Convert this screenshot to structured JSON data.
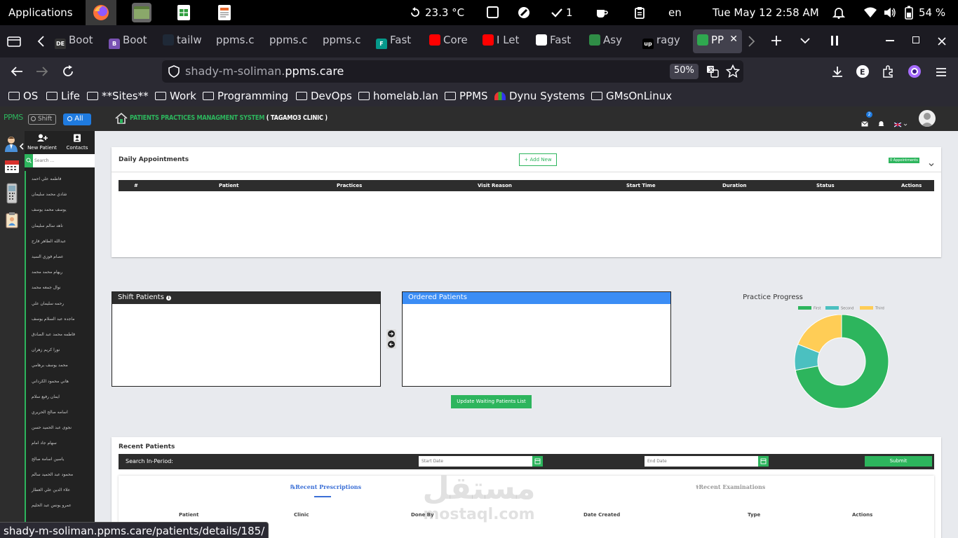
{
  "os_bar": {
    "applications": "Applications",
    "temperature": "23.3 °C",
    "check_count": "1",
    "language": "en",
    "datetime": "Tue May 12  2:58 AM",
    "battery": "54 %"
  },
  "browser": {
    "tabs": [
      {
        "label": "Boot",
        "icon": "DE",
        "color": "#333"
      },
      {
        "label": "Boot",
        "icon": "B",
        "color": "#7952b3"
      },
      {
        "label": "tailw",
        "icon": "tailwind-icon",
        "color": "#1f2937"
      },
      {
        "label": "ppms.c",
        "icon": "",
        "color": ""
      },
      {
        "label": "ppms.c",
        "icon": "",
        "color": ""
      },
      {
        "label": "ppms.c",
        "icon": "",
        "color": ""
      },
      {
        "label": "Fast",
        "icon": "F",
        "color": "#05998b"
      },
      {
        "label": "Core",
        "icon": "youtube-icon",
        "color": "#f00"
      },
      {
        "label": "I Let",
        "icon": "youtube-icon",
        "color": "#f00"
      },
      {
        "label": "Fast",
        "icon": "github-icon",
        "color": "#fff"
      },
      {
        "label": "Asy",
        "icon": "gfg-icon",
        "color": "#2f8d46"
      },
      {
        "label": "ragy",
        "icon": "up",
        "color": "#000"
      },
      {
        "label": "PP",
        "icon": "ppms-icon",
        "color": "#2fa84f"
      }
    ],
    "url_domain_prefix": "shady-m-soliman.",
    "url_domain_main": "ppms.care",
    "zoom": "50%",
    "bookmarks": [
      "OS",
      "Life",
      "**Sites**",
      "Work",
      "Programming",
      "DevOps",
      "homelab.lan",
      "PPMS",
      "Dynu Systems",
      "GMsOnLinux"
    ],
    "status_url": "shady-m-soliman.ppms.care/patients/details/185/"
  },
  "app": {
    "brand": "PPMS",
    "toggle_shift": "Shift",
    "toggle_all": "All",
    "title": "Patients Practices Managment System",
    "clinic": "( Tagamo3 Clinic )",
    "mail_badge": "2",
    "new_patient": "New Patient",
    "contacts": "Contacts",
    "search_placeholder": "Search ...",
    "patients": [
      "فاطمه علي احمد",
      "شادي محمد سليمان",
      "يوسف محمد يوسف",
      "ناهد سالم سليمان",
      "عبدالله الطاهر فارح",
      "عصام فوزي السيد",
      "ريهام محمد محمد",
      "نوال جمعه محمد",
      "رحمه سليمان علي",
      "ماجده عبد السلام يوسف",
      "فاطمه محمد عبد الصادق",
      "نورا كريم زهران",
      "محمد يوسف برهامي",
      "هاني محمود الكرداني",
      "ايمان رفيع سلام",
      "اسامه صالح الحريري",
      "نجوى عبد الحميد حسن",
      "سهام جاد امام",
      "ياسين اسامة صالح",
      "محمود عبد الحميد سالم",
      "علاء الدين علي العطار",
      "عمرو يونس عبد الحليم"
    ]
  },
  "daily": {
    "title": "Daily Appointments",
    "add_new": "+ Add New",
    "badge": "0 Appointments",
    "columns": [
      "#",
      "Patient",
      "Practices",
      "Visit Reason",
      "Start Time",
      "Duration",
      "Status",
      "Actions"
    ]
  },
  "queue": {
    "shift_title": "Shift Patients",
    "ordered_title": "Ordered Patients",
    "update_btn": "Update Waiting Patients List"
  },
  "chart_data": {
    "type": "pie",
    "title": "Practice Progress",
    "labels": [
      "First",
      "Second",
      "Third"
    ],
    "values": [
      72,
      9,
      19
    ],
    "colors": [
      "#2db55d",
      "#4bc0c0",
      "#ffcd56"
    ]
  },
  "recent": {
    "title": "Recent Patients",
    "search_label": "Search In-Period:",
    "start_placeholder": "Start Date",
    "end_placeholder": "End Date",
    "submit": "Submit",
    "tab_prescriptions": "Recent Prescriptions",
    "tab_examinations": "Recent Examinations",
    "columns": [
      "Patient",
      "Clinic",
      "Done By",
      "Date Created",
      "Type",
      "Actions"
    ]
  },
  "watermark": {
    "arabic": "مستقل",
    "latin": "mostaql.com"
  }
}
